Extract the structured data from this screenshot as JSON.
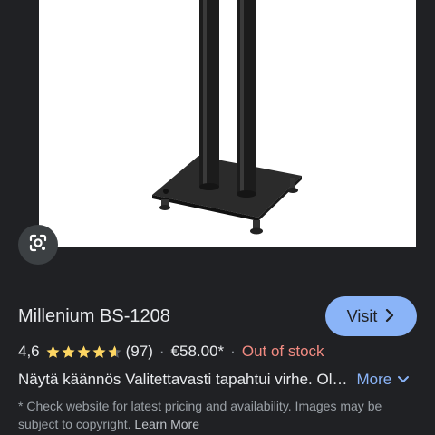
{
  "product": {
    "title": "Millenium BS-1208",
    "rating": "4,6",
    "rating_value": 4.6,
    "rating_max": 5,
    "review_count": "(97)",
    "price": "€58.00*",
    "stock_status": "Out of stock",
    "description": "Näytä käännös Valitettavasti tapahtui virhe. Ol…",
    "more_label": "More",
    "disclaimer": "* Check website for latest pricing and availability. Images may be subject to copyright.",
    "learn_more_label": "Learn More"
  },
  "actions": {
    "visit_label": "Visit",
    "visit_icon": "chevron-right-icon",
    "lens_icon": "google-lens-icon"
  },
  "separators": {
    "dot": "·"
  },
  "colors": {
    "background": "#202124",
    "accent": "#8ab4f8",
    "star": "#fdd663",
    "out_of_stock": "#f28b82",
    "muted_text": "#9aa0a6"
  }
}
